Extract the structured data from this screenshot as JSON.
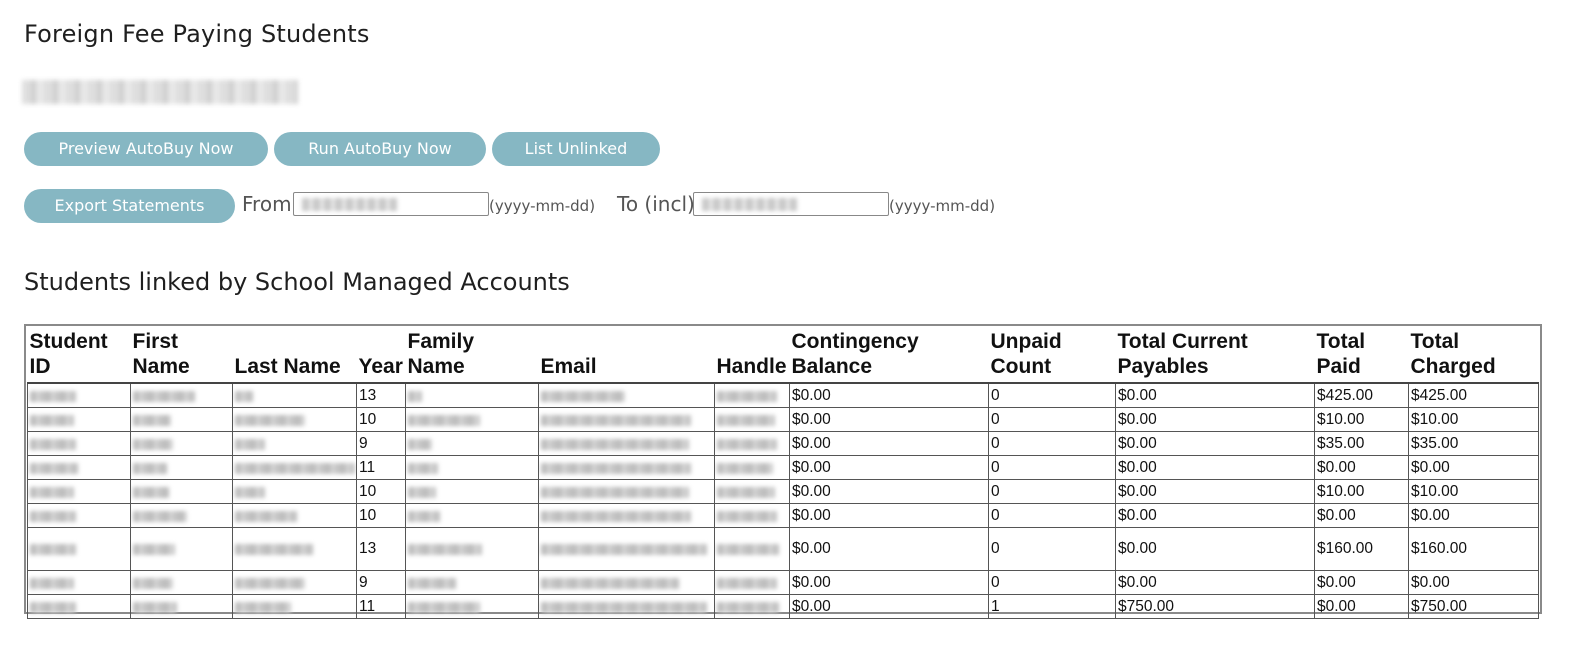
{
  "page_title": "Foreign Fee Paying Students",
  "buttons": {
    "preview_autobuy": "Preview AutoBuy Now",
    "run_autobuy": "Run AutoBuy Now",
    "list_unlinked": "List Unlinked",
    "export_statements": "Export Statements"
  },
  "export": {
    "from_label": "From",
    "to_label": "To (incl)",
    "date_format_hint": "(yyyy-mm-dd)"
  },
  "section_title": "Students linked by School Managed Accounts",
  "table": {
    "headers": [
      "Student ID",
      "First Name",
      "Last Name",
      "Year",
      "Family Name",
      "Email",
      "Handle",
      "Contingency Balance",
      "Unpaid Count",
      "Total Current Payables",
      "Total Paid",
      "Total Charged"
    ],
    "rows": [
      {
        "year": "13",
        "contingency_balance": "$0.00",
        "unpaid_count": "0",
        "total_current_payables": "$0.00",
        "total_paid": "$425.00",
        "total_charged": "$425.00"
      },
      {
        "year": "10",
        "contingency_balance": "$0.00",
        "unpaid_count": "0",
        "total_current_payables": "$0.00",
        "total_paid": "$10.00",
        "total_charged": "$10.00"
      },
      {
        "year": "9",
        "contingency_balance": "$0.00",
        "unpaid_count": "0",
        "total_current_payables": "$0.00",
        "total_paid": "$35.00",
        "total_charged": "$35.00"
      },
      {
        "year": "11",
        "contingency_balance": "$0.00",
        "unpaid_count": "0",
        "total_current_payables": "$0.00",
        "total_paid": "$0.00",
        "total_charged": "$0.00"
      },
      {
        "year": "10",
        "contingency_balance": "$0.00",
        "unpaid_count": "0",
        "total_current_payables": "$0.00",
        "total_paid": "$10.00",
        "total_charged": "$10.00"
      },
      {
        "year": "10",
        "contingency_balance": "$0.00",
        "unpaid_count": "0",
        "total_current_payables": "$0.00",
        "total_paid": "$0.00",
        "total_charged": "$0.00"
      },
      {
        "year": "13",
        "contingency_balance": "$0.00",
        "unpaid_count": "0",
        "total_current_payables": "$0.00",
        "total_paid": "$160.00",
        "total_charged": "$160.00"
      },
      {
        "year": "9",
        "contingency_balance": "$0.00",
        "unpaid_count": "0",
        "total_current_payables": "$0.00",
        "total_paid": "$0.00",
        "total_charged": "$0.00"
      },
      {
        "year": "11",
        "contingency_balance": "$0.00",
        "unpaid_count": "1",
        "total_current_payables": "$750.00",
        "total_paid": "$0.00",
        "total_charged": "$750.00"
      }
    ]
  },
  "colors": {
    "button_bg": "#86b7c3",
    "button_text": "#ffffff"
  }
}
